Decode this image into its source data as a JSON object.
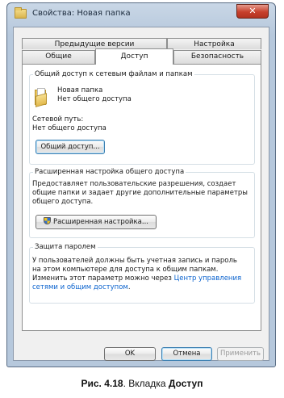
{
  "window": {
    "title": "Свойства: Новая папка",
    "close_glyph": "✕"
  },
  "tabs": {
    "row_back": [
      "Предыдущие версии",
      "Настройка"
    ],
    "row_front": [
      "Общие",
      "Доступ",
      "Безопасность"
    ],
    "active": "Доступ"
  },
  "sharing": {
    "group_title": "Общий доступ к сетевым файлам и папкам",
    "folder_name": "Новая папка",
    "folder_status": "Нет общего доступа",
    "network_path_label": "Сетевой путь:",
    "network_path_value": "Нет общего доступа",
    "share_button": "Общий доступ..."
  },
  "advanced": {
    "group_title": "Расширенная настройка общего доступа",
    "description_lines": [
      "Предоставляет пользовательские разрешения, создает",
      "общие папки и задает другие дополнительные параметры",
      "общего доступа."
    ],
    "button": "Расширенная настройка..."
  },
  "password": {
    "group_title": "Защита паролем",
    "text_lines": [
      "У пользователей должны быть учетная запись и пароль",
      "на этом компьютере для доступа к общим папкам.",
      "Изменить этот параметр можно через "
    ],
    "link_part1": "Центр управления",
    "link_part2": "сетями и общим доступом",
    "link_tail": "."
  },
  "buttons": {
    "ok": "OK",
    "cancel": "Отмена",
    "apply": "Применить"
  },
  "caption": {
    "prefix": "Рис. 4.18",
    "middle": ". Вкладка ",
    "bold": "Доступ"
  }
}
